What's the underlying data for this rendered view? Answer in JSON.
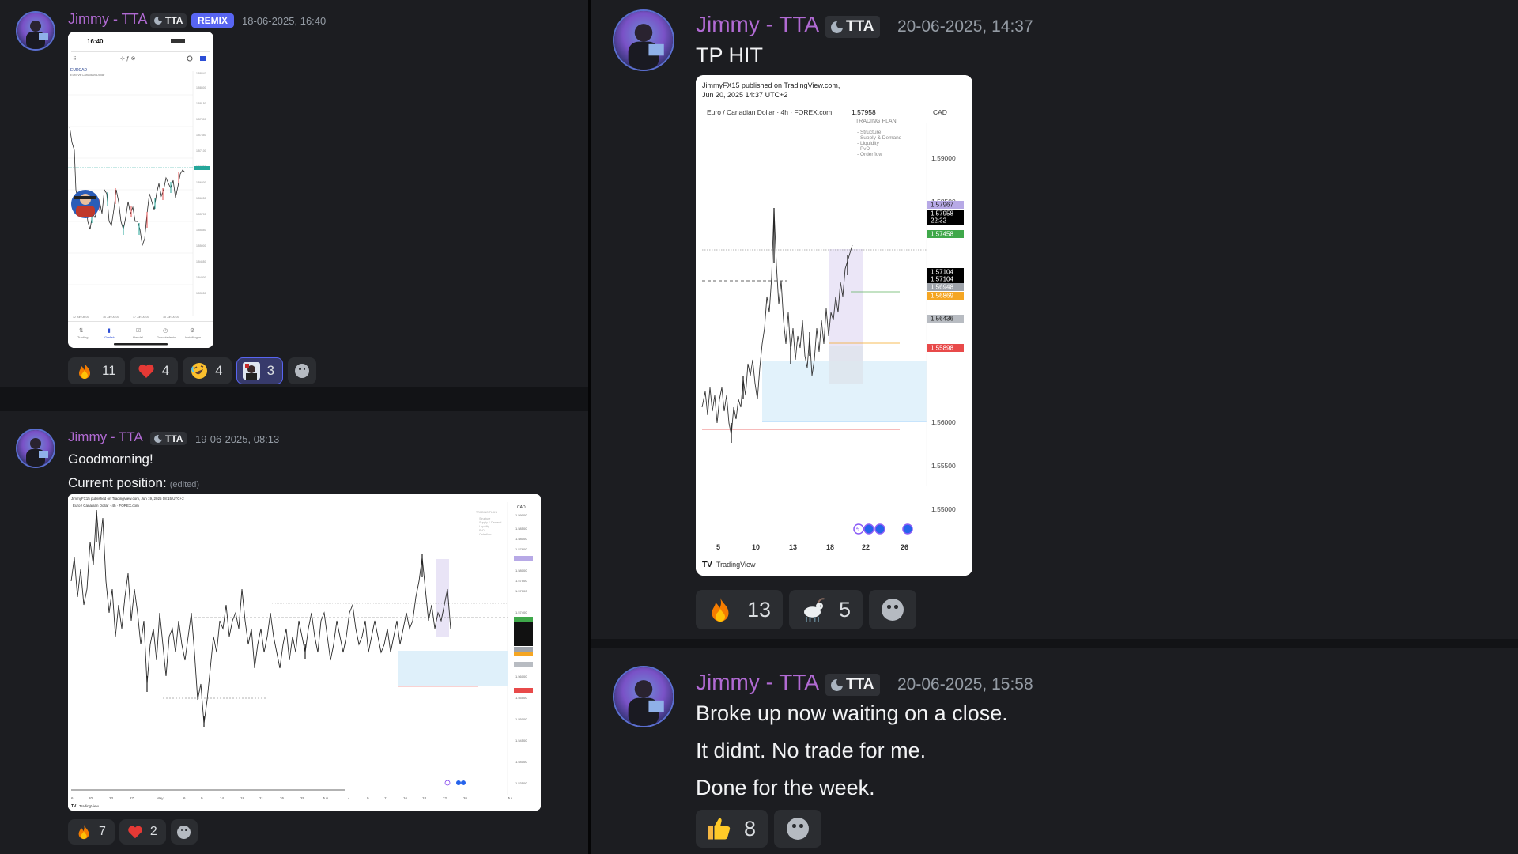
{
  "messages": {
    "m1": {
      "username": "Jimmy - TTA",
      "tag": "TTA",
      "badge": "REMIX",
      "timestamp": "18-06-2025, 16:40",
      "phone": {
        "time": "16:40",
        "pair": "EURCAD",
        "subtitle": "Euro vs Canadian Dollar"
      },
      "reactions": [
        {
          "emoji": "fire-icon",
          "count": "11",
          "active": false
        },
        {
          "emoji": "heart-icon",
          "count": "4",
          "active": false
        },
        {
          "emoji": "rofl-icon",
          "count": "4",
          "active": false
        },
        {
          "emoji": "custom-avatar-emoji",
          "count": "3",
          "active": true
        }
      ]
    },
    "m2": {
      "username": "Jimmy - TTA",
      "tag": "TTA",
      "timestamp": "19-06-2025, 08:13",
      "lines": [
        "Goodmorning!",
        "Current position:"
      ],
      "edited": "(edited)",
      "chart": {
        "header": "JimmyFX15 published on TradingView.com, Jun 19, 2025 08:15 UTC+2",
        "title": "Euro / Canadian Dollar · 4h · FOREX.com",
        "currency": "CAD",
        "brand": "TradingView",
        "x_labels": [
          "6",
          "20",
          "23",
          "27",
          "May",
          "6",
          "9",
          "14",
          "18",
          "21",
          "26",
          "29",
          "Jun",
          "4",
          "9",
          "11",
          "16",
          "18",
          "22",
          "26",
          "Jul"
        ]
      },
      "reactions": [
        {
          "emoji": "fire-icon",
          "count": "7",
          "active": false
        },
        {
          "emoji": "heart-icon",
          "count": "2",
          "active": false
        }
      ]
    },
    "m3": {
      "username": "Jimmy - TTA",
      "tag": "TTA",
      "timestamp": "20-06-2025, 14:37",
      "lines": [
        "TP HIT"
      ],
      "chart": {
        "header_line1": "JimmyFX15 published on TradingView.com,",
        "header_line2": "Jun 20, 2025 14:37 UTC+2",
        "title": "Euro / Canadian Dollar · 4h · FOREX.com",
        "last_price": "1.57958",
        "currency": "CAD",
        "plan_title": "TRADING PLAN",
        "plan_items": [
          "- Structure",
          "- Supply & Demand",
          "- Liquidity",
          "- PvD",
          "- Orderflow"
        ],
        "y_labels": [
          "1.59000",
          "1.58500",
          "1.56000",
          "1.55500",
          "1.55000"
        ],
        "price_tags": [
          {
            "label": "1.57967",
            "color": "#b7a9e6",
            "text": "#222"
          },
          {
            "label": "1.57958",
            "color": "#000000",
            "text": "#fff"
          },
          {
            "label": "22:32",
            "color": "#000000",
            "text": "#fff"
          },
          {
            "label": "1.57458",
            "color": "#3fa84a",
            "text": "#fff"
          },
          {
            "label": "1.57104",
            "color": "#000000",
            "text": "#fff"
          },
          {
            "label": "1.57104",
            "color": "#000000",
            "text": "#fff"
          },
          {
            "label": "1.56948",
            "color": "#9ea3aa",
            "text": "#fff"
          },
          {
            "label": "1.56869",
            "color": "#f5a623",
            "text": "#fff"
          },
          {
            "label": "1.56436",
            "color": "#b8bcc2",
            "text": "#222"
          },
          {
            "label": "1.55898",
            "color": "#e84a4a",
            "text": "#fff"
          }
        ],
        "x_labels": [
          "5",
          "10",
          "13",
          "18",
          "22",
          "26"
        ],
        "brand": "TradingView"
      },
      "reactions": [
        {
          "emoji": "fire-icon",
          "count": "13",
          "active": false
        },
        {
          "emoji": "goat-icon",
          "count": "5",
          "active": false
        }
      ]
    },
    "m4": {
      "username": "Jimmy - TTA",
      "tag": "TTA",
      "timestamp": "20-06-2025, 15:58",
      "lines": [
        "Broke up now waiting on a close.",
        "It didnt. No trade for me.",
        "Done for the week."
      ],
      "reactions": [
        {
          "emoji": "thumbs-up-icon",
          "count": "8",
          "active": false
        }
      ]
    }
  }
}
